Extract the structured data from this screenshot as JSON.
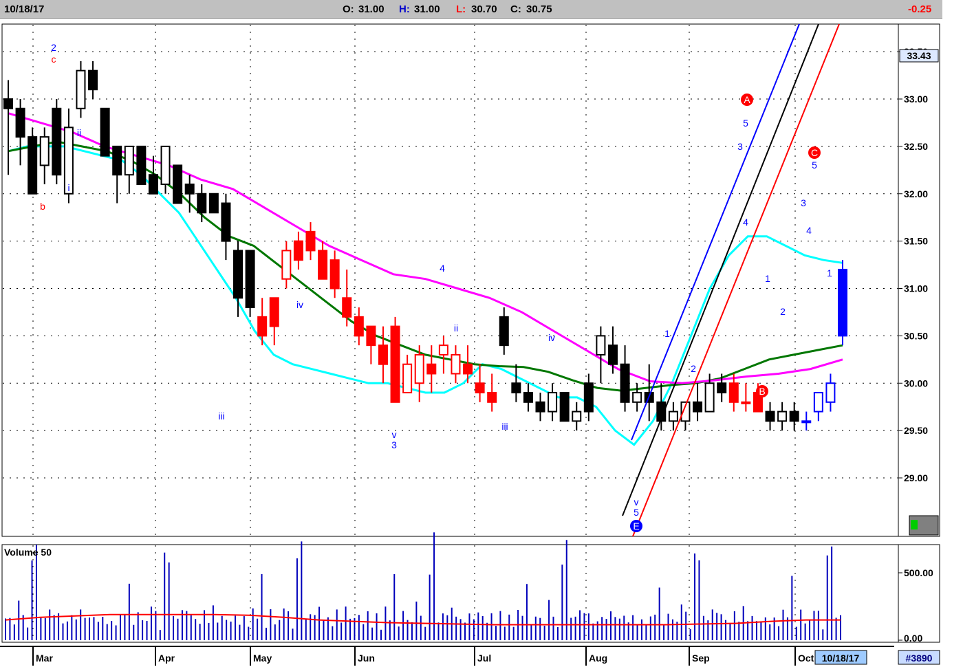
{
  "header": {
    "date": "10/18/17",
    "open_label": "O:",
    "open": "31.00",
    "high_label": "H:",
    "high": "31.00",
    "low_label": "L:",
    "low": "30.70",
    "close_label": "C:",
    "close": "30.75",
    "change": "-0.25"
  },
  "price_badge": "33.43",
  "volume_panel_label": "Volume 50",
  "footer": {
    "date_box": "10/18/17",
    "id": "#3890"
  },
  "colors": {
    "down": "#000000",
    "correction": "#ff0000",
    "impulse": "#0000ff",
    "ma_short": "#00ffff",
    "ma_mid": "#007700",
    "ma_long": "#ff00ff",
    "volume": "#0000bb",
    "volume_avg": "#ff0000",
    "header_bg": "#c0c0c0"
  },
  "chart_data": {
    "type": "candlestick",
    "price_axis": {
      "ylim": [
        28.5,
        33.6
      ],
      "ticks": [
        "29.00",
        "29.50",
        "30.00",
        "30.50",
        "31.00",
        "31.50",
        "32.00",
        "32.50",
        "33.00",
        "33.50"
      ]
    },
    "volume_axis": {
      "ylim": [
        0,
        700
      ],
      "ticks": [
        "0.00",
        "500.00"
      ]
    },
    "x_axis": {
      "labels": [
        "Mar",
        "Apr",
        "May",
        "Jun",
        "Jul",
        "Aug",
        "Sep",
        "Oct"
      ],
      "label_index": [
        1,
        15,
        24,
        34,
        45,
        55,
        66,
        76
      ]
    },
    "candles": [
      {
        "o": 33.0,
        "h": 33.2,
        "l": 32.2,
        "c": 32.9
      },
      {
        "o": 32.9,
        "h": 33.0,
        "l": 32.3,
        "c": 32.6
      },
      {
        "o": 32.6,
        "h": 32.7,
        "l": 32.0,
        "c": 32.0
      },
      {
        "o": 32.3,
        "h": 32.7,
        "l": 32.1,
        "c": 32.6
      },
      {
        "o": 32.9,
        "h": 33.0,
        "l": 32.1,
        "c": 32.2
      },
      {
        "o": 32.0,
        "h": 32.9,
        "l": 31.9,
        "c": 32.7
      },
      {
        "o": 32.9,
        "h": 33.4,
        "l": 32.8,
        "c": 33.3
      },
      {
        "o": 33.3,
        "h": 33.4,
        "l": 33.0,
        "c": 33.1
      },
      {
        "o": 32.9,
        "h": 32.9,
        "l": 32.4,
        "c": 32.4
      },
      {
        "o": 32.5,
        "h": 32.5,
        "l": 31.9,
        "c": 32.2
      },
      {
        "o": 32.2,
        "h": 32.5,
        "l": 32.0,
        "c": 32.5
      },
      {
        "o": 32.5,
        "h": 32.5,
        "l": 32.1,
        "c": 32.1
      },
      {
        "o": 32.2,
        "h": 32.4,
        "l": 32.0,
        "c": 32.0
      },
      {
        "o": 32.1,
        "h": 32.5,
        "l": 32.0,
        "c": 32.5
      },
      {
        "o": 32.3,
        "h": 32.3,
        "l": 31.9,
        "c": 31.9
      },
      {
        "o": 32.1,
        "h": 32.2,
        "l": 31.8,
        "c": 32.0
      },
      {
        "o": 32.0,
        "h": 32.1,
        "l": 31.7,
        "c": 31.8
      },
      {
        "o": 32.0,
        "h": 32.0,
        "l": 31.8,
        "c": 31.8
      },
      {
        "o": 31.9,
        "h": 32.0,
        "l": 31.3,
        "c": 31.5
      },
      {
        "o": 31.4,
        "h": 31.5,
        "l": 30.7,
        "c": 30.9
      },
      {
        "o": 31.4,
        "h": 31.4,
        "l": 30.7,
        "c": 30.8
      },
      {
        "o": 30.7,
        "h": 30.9,
        "l": 30.4,
        "c": 30.5
      },
      {
        "o": 30.9,
        "h": 30.9,
        "l": 30.4,
        "c": 30.6
      },
      {
        "o": 31.1,
        "h": 31.5,
        "l": 31.0,
        "c": 31.4
      },
      {
        "o": 31.5,
        "h": 31.6,
        "l": 31.2,
        "c": 31.3
      },
      {
        "o": 31.6,
        "h": 31.7,
        "l": 31.3,
        "c": 31.4
      },
      {
        "o": 31.4,
        "h": 31.5,
        "l": 31.1,
        "c": 31.1
      },
      {
        "o": 31.3,
        "h": 31.4,
        "l": 30.9,
        "c": 31.0
      },
      {
        "o": 30.9,
        "h": 31.2,
        "l": 30.6,
        "c": 30.7
      },
      {
        "o": 30.7,
        "h": 30.8,
        "l": 30.4,
        "c": 30.5
      },
      {
        "o": 30.6,
        "h": 30.6,
        "l": 30.2,
        "c": 30.4
      },
      {
        "o": 30.4,
        "h": 30.6,
        "l": 30.0,
        "c": 30.2
      },
      {
        "o": 30.6,
        "h": 30.7,
        "l": 29.8,
        "c": 29.8
      },
      {
        "o": 29.9,
        "h": 30.3,
        "l": 29.9,
        "c": 30.2
      },
      {
        "o": 30.0,
        "h": 30.4,
        "l": 29.8,
        "c": 30.3
      },
      {
        "o": 30.2,
        "h": 30.4,
        "l": 29.9,
        "c": 30.1
      },
      {
        "o": 30.3,
        "h": 30.5,
        "l": 30.1,
        "c": 30.4
      },
      {
        "o": 30.1,
        "h": 30.4,
        "l": 30.0,
        "c": 30.3
      },
      {
        "o": 30.2,
        "h": 30.4,
        "l": 30.0,
        "c": 30.1
      },
      {
        "o": 30.0,
        "h": 30.2,
        "l": 29.8,
        "c": 29.9
      },
      {
        "o": 29.9,
        "h": 30.1,
        "l": 29.7,
        "c": 29.8
      },
      {
        "o": 30.7,
        "h": 30.8,
        "l": 30.3,
        "c": 30.4
      },
      {
        "o": 30.0,
        "h": 30.2,
        "l": 29.8,
        "c": 29.9
      },
      {
        "o": 29.9,
        "h": 30.0,
        "l": 29.7,
        "c": 29.8
      },
      {
        "o": 29.8,
        "h": 29.9,
        "l": 29.6,
        "c": 29.7
      }
    ],
    "candles_b": [
      {
        "o": 29.7,
        "h": 30.0,
        "l": 29.6,
        "c": 29.9
      },
      {
        "o": 29.9,
        "h": 29.9,
        "l": 29.6,
        "c": 29.6
      },
      {
        "o": 29.6,
        "h": 29.8,
        "l": 29.5,
        "c": 29.7
      },
      {
        "o": 30.0,
        "h": 30.1,
        "l": 29.6,
        "c": 29.7
      },
      {
        "o": 30.3,
        "h": 30.6,
        "l": 30.0,
        "c": 30.5
      },
      {
        "o": 30.4,
        "h": 30.6,
        "l": 30.1,
        "c": 30.2
      },
      {
        "o": 30.2,
        "h": 30.4,
        "l": 29.7,
        "c": 29.8
      },
      {
        "o": 29.8,
        "h": 30.0,
        "l": 29.7,
        "c": 29.9
      },
      {
        "o": 29.9,
        "h": 30.2,
        "l": 29.6,
        "c": 29.8
      },
      {
        "o": 29.8,
        "h": 30.0,
        "l": 29.5,
        "c": 29.6
      },
      {
        "o": 29.6,
        "h": 29.8,
        "l": 29.5,
        "c": 29.7
      },
      {
        "o": 29.6,
        "h": 29.8,
        "l": 29.5,
        "c": 29.8
      },
      {
        "o": 29.8,
        "h": 30.0,
        "l": 29.6,
        "c": 29.7
      },
      {
        "o": 29.7,
        "h": 30.1,
        "l": 29.7,
        "c": 30.0
      },
      {
        "o": 30.0,
        "h": 30.1,
        "l": 29.8,
        "c": 29.9
      },
      {
        "o": 30.0,
        "h": 30.1,
        "l": 29.7,
        "c": 29.8
      },
      {
        "o": 29.8,
        "h": 30.0,
        "l": 29.7,
        "c": 29.8
      },
      {
        "o": 29.9,
        "h": 30.0,
        "l": 29.7,
        "c": 29.7
      },
      {
        "o": 29.7,
        "h": 29.8,
        "l": 29.5,
        "c": 29.6
      },
      {
        "o": 29.6,
        "h": 29.8,
        "l": 29.5,
        "c": 29.7
      },
      {
        "o": 29.7,
        "h": 29.8,
        "l": 29.5,
        "c": 29.6
      },
      {
        "o": 29.6,
        "h": 29.7,
        "l": 29.5,
        "c": 29.6
      },
      {
        "o": 29.7,
        "h": 29.9,
        "l": 29.6,
        "c": 29.9
      },
      {
        "o": 29.8,
        "h": 30.1,
        "l": 29.7,
        "c": 30.0
      },
      {
        "o": 31.2,
        "h": 31.3,
        "l": 30.4,
        "c": 30.5
      }
    ],
    "moving_averages": [
      {
        "name": "ma_short",
        "values": [
          32.45,
          32.5,
          32.5,
          32.5,
          32.45,
          32.4,
          32.35,
          32.2,
          32.0,
          31.8,
          31.5,
          31.2,
          30.9,
          30.55,
          30.3,
          30.2,
          30.15,
          30.1,
          30.05,
          30.0,
          30.0,
          29.95,
          29.9,
          29.9,
          30.0,
          30.2,
          30.15,
          30.05,
          29.95,
          29.85,
          29.85,
          29.75,
          29.5,
          29.35,
          29.6,
          30.0,
          30.5,
          31.0,
          31.35,
          31.55,
          31.55,
          31.45,
          31.35,
          31.3,
          31.27
        ]
      },
      {
        "name": "ma_mid",
        "values": [
          32.45,
          32.5,
          32.55,
          32.5,
          32.45,
          32.35,
          32.2,
          32.0,
          31.75,
          31.55,
          31.45,
          31.25,
          31.05,
          30.85,
          30.65,
          30.5,
          30.4,
          30.3,
          30.25,
          30.2,
          30.18,
          30.17,
          30.12,
          30.03,
          29.95,
          29.92,
          29.95,
          29.98,
          30.0,
          30.05,
          30.15,
          30.25,
          30.3,
          30.35,
          30.4
        ]
      },
      {
        "name": "ma_long",
        "values": [
          32.85,
          32.75,
          32.65,
          32.5,
          32.4,
          32.3,
          32.15,
          32.05,
          31.85,
          31.65,
          31.45,
          31.3,
          31.15,
          31.1,
          31.0,
          30.9,
          30.75,
          30.55,
          30.35,
          30.15,
          30.02,
          30.0,
          30.03,
          30.07,
          30.1,
          30.15,
          30.25
        ]
      }
    ],
    "volume": [
      230,
      165,
      150,
      300,
      220,
      100,
      650,
      800,
      180,
      200,
      230,
      250,
      200,
      170,
      140,
      230,
      160,
      260,
      180,
      180,
      200,
      140,
      220,
      120,
      200,
      110,
      250,
      190,
      500,
      120
    ],
    "volume_avg": [
      150,
      170,
      180,
      190,
      190,
      190,
      190,
      185,
      170,
      150,
      140,
      130,
      125,
      120,
      115,
      115,
      115,
      115,
      115,
      115,
      120,
      125,
      140,
      150,
      150
    ]
  }
}
